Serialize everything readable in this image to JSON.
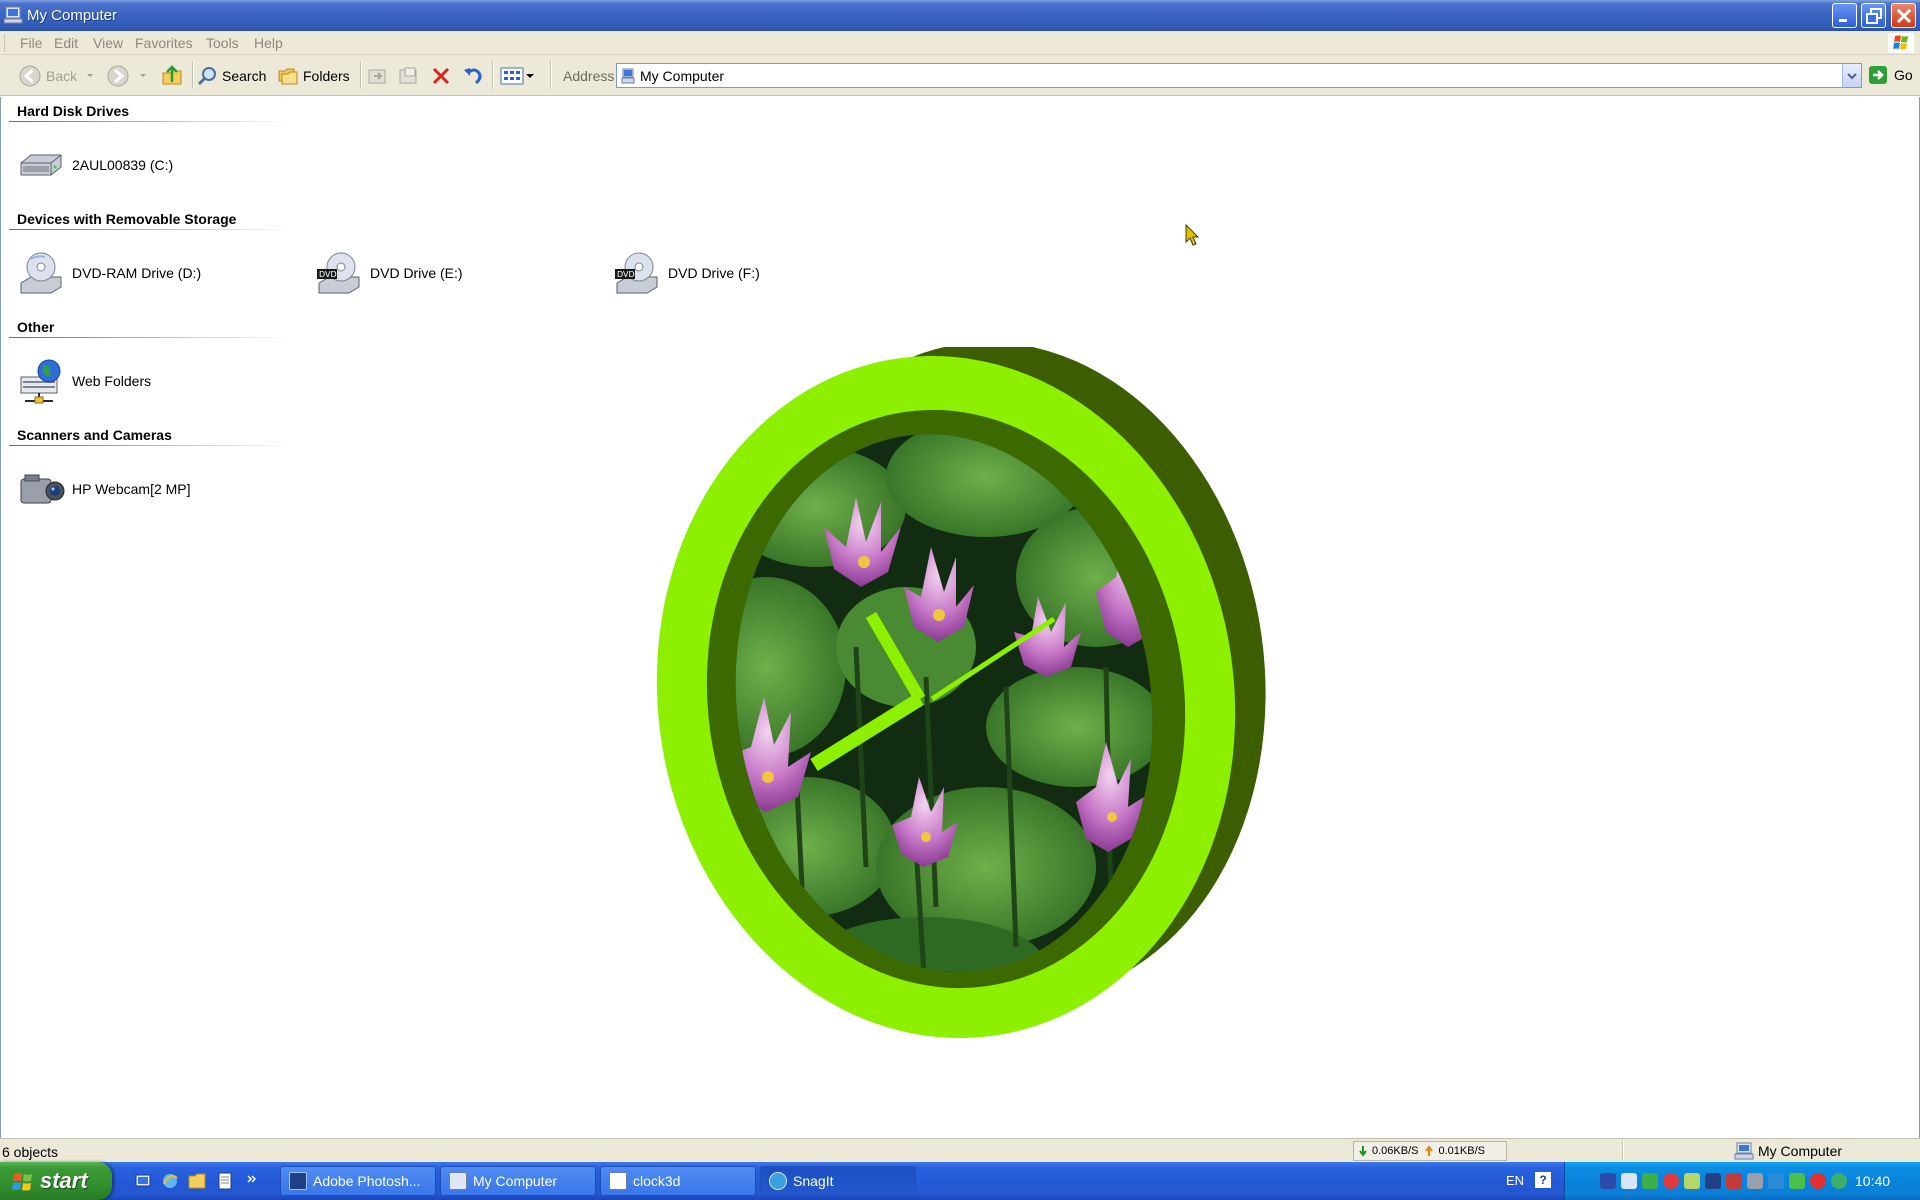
{
  "window": {
    "title": "My Computer"
  },
  "menubar": {
    "items": [
      "File",
      "Edit",
      "View",
      "Favorites",
      "Tools",
      "Help"
    ]
  },
  "toolbar": {
    "back_label": "Back",
    "search_label": "Search",
    "folders_label": "Folders",
    "address_label": "Address",
    "address_value": "My Computer",
    "go_label": "Go"
  },
  "groups": {
    "hard_disk": {
      "header": "Hard Disk Drives",
      "items": [
        {
          "label": "2AUL00839 (C:)",
          "icon": "hard-disk-icon"
        }
      ]
    },
    "removable": {
      "header": "Devices with Removable Storage",
      "items": [
        {
          "label": "DVD-RAM Drive (D:)",
          "icon": "dvd-ram-drive-icon"
        },
        {
          "label": "DVD Drive (E:)",
          "icon": "dvd-drive-icon"
        },
        {
          "label": "DVD Drive (F:)",
          "icon": "dvd-drive-icon"
        }
      ]
    },
    "other": {
      "header": "Other",
      "items": [
        {
          "label": "Web Folders",
          "icon": "web-folders-icon"
        }
      ]
    },
    "scanners": {
      "header": "Scanners and Cameras",
      "items": [
        {
          "label": "HP Webcam[2 MP]",
          "icon": "webcam-icon"
        }
      ]
    }
  },
  "clock": {
    "rim_color": "#8cf000",
    "side_color": "#3d5e00",
    "hand_color": "#8cf000"
  },
  "statusbar": {
    "objects": "6 objects",
    "download": "0.06KB/S",
    "upload": "0.01KB/S",
    "zone": "My Computer"
  },
  "taskbar": {
    "start_label": "start",
    "tasks": [
      {
        "label": "Adobe Photosh...",
        "icon": "photoshop-icon"
      },
      {
        "label": "My Computer",
        "icon": "my-computer-icon"
      },
      {
        "label": "clock3d",
        "icon": "window-icon"
      },
      {
        "label": "SnagIt",
        "icon": "snagit-icon"
      }
    ],
    "language": "EN",
    "help": "?",
    "time": "10:40"
  }
}
